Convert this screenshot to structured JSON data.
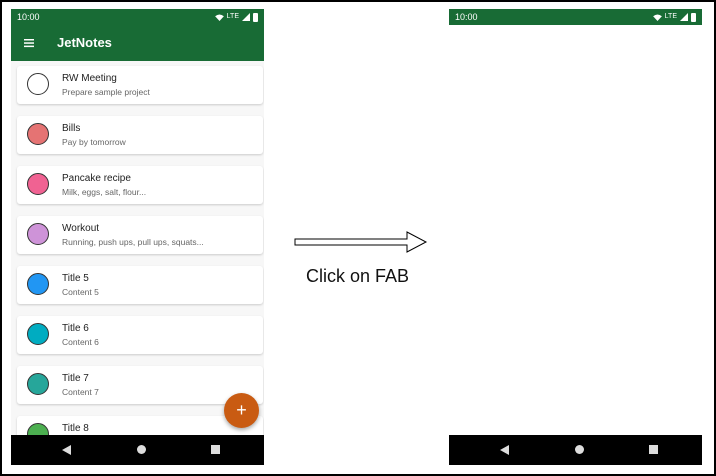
{
  "left_screen": {
    "status_time": "10:00",
    "status_network": "LTE",
    "app_title": "JetNotes",
    "notes": [
      {
        "title": "RW Meeting",
        "content": "Prepare sample project",
        "color": "#ffffff"
      },
      {
        "title": "Bills",
        "content": "Pay by tomorrow",
        "color": "#e57373"
      },
      {
        "title": "Pancake recipe",
        "content": "Milk, eggs, salt, flour...",
        "color": "#f06292"
      },
      {
        "title": "Workout",
        "content": "Running, push ups, pull ups, squats...",
        "color": "#ce93d8"
      },
      {
        "title": "Title 5",
        "content": "Content 5",
        "color": "#2196f3"
      },
      {
        "title": "Title 6",
        "content": "Content 6",
        "color": "#00acc1"
      },
      {
        "title": "Title 7",
        "content": "Content 7",
        "color": "#26a69a"
      },
      {
        "title": "Title 8",
        "content": "",
        "color": "#4caf50"
      }
    ],
    "fab_label": "+"
  },
  "caption": "Click on FAB",
  "right_screen": {
    "status_time": "10:00",
    "status_network": "LTE"
  },
  "colors": {
    "app_bar": "#186b35",
    "fab": "#c95b12",
    "nav_bar": "#000000"
  },
  "icons": {
    "menu": "hamburger-menu-icon",
    "wifi": "wifi-icon",
    "signal": "signal-icon",
    "battery": "battery-icon",
    "back": "nav-back-icon",
    "home": "nav-home-icon",
    "recents": "nav-recents-icon",
    "arrow": "right-arrow-icon"
  }
}
